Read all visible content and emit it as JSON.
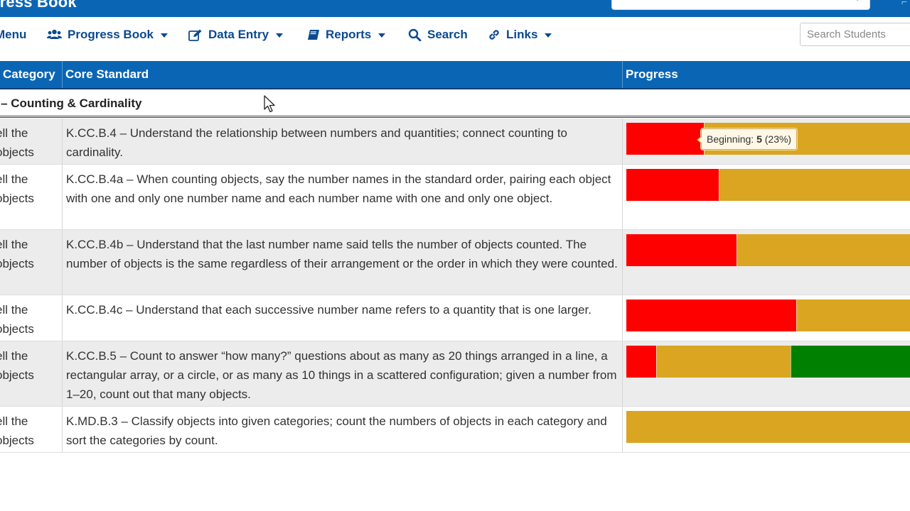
{
  "app": {
    "title": "gress Book"
  },
  "nav": {
    "menu_label": "Menu",
    "items": [
      {
        "label": "Progress Book",
        "icon": "users-icon"
      },
      {
        "label": "Data Entry",
        "icon": "edit-icon"
      },
      {
        "label": "Reports",
        "icon": "book-icon"
      },
      {
        "label": "Search",
        "icon": "search-icon"
      },
      {
        "label": "Links",
        "icon": "link-icon"
      }
    ],
    "search_placeholder": "Search Students"
  },
  "table": {
    "headers": {
      "category": "Category",
      "standard": "Core Standard",
      "progress": "Progress"
    },
    "section_title": "n – Counting & Cardinality",
    "category_text": "ell the\nobjects",
    "rows": [
      {
        "category": "ell the\nobjects",
        "standard": "K.CC.B.4 – Understand the relationship between numbers and quantities; connect counting to cardinality.",
        "progress": {
          "beginning": 0.26,
          "developing": 0.74,
          "secure": 0
        }
      },
      {
        "category": "ell the\nobjects",
        "standard": "K.CC.B.4a – When counting objects, say the number names in the standard order, pairing each object with one and only one number name and each number name with one and only one object.",
        "progress": {
          "beginning": 0.31,
          "developing": 0.69,
          "secure": 0
        }
      },
      {
        "category": "ell the\nobjects",
        "standard": "K.CC.B.4b – Understand that the last number name said tells the number of objects counted. The number of objects is the same regardless of their arrangement or the order in which they were counted.",
        "progress": {
          "beginning": 0.37,
          "developing": 0.63,
          "secure": 0
        }
      },
      {
        "category": "ell the\nobjects",
        "standard": "K.CC.B.4c – Understand that each successive number name refers to a quantity that is one larger.",
        "progress": {
          "beginning": 0.57,
          "developing": 0.43,
          "secure": 0
        }
      },
      {
        "category": "ell the\nobjects",
        "standard": "K.CC.B.5 – Count to answer “how many?” questions about as many as 20 things arranged in a line, a rectangular array, or a circle, or as many as 10 things in a scattered configuration; given a number from 1–20, count out that many objects.",
        "progress": {
          "beginning": 0.1,
          "developing": 0.45,
          "secure": 0.45
        }
      },
      {
        "category": "ell the\nobjects",
        "standard": "K.MD.B.3 – Classify objects into given categories; count the numbers of objects in each category and sort the categories by count.",
        "progress": {
          "beginning": 0,
          "developing": 1,
          "secure": 0
        }
      }
    ]
  },
  "tooltip": {
    "label": "Beginning: ",
    "count": "5",
    "percent": "(23%)"
  },
  "colors": {
    "header_blue": "#0a66b5",
    "nav_text": "#0a4a8f",
    "beginning": "#ff0000",
    "developing": "#daa520",
    "secure": "#008000"
  }
}
